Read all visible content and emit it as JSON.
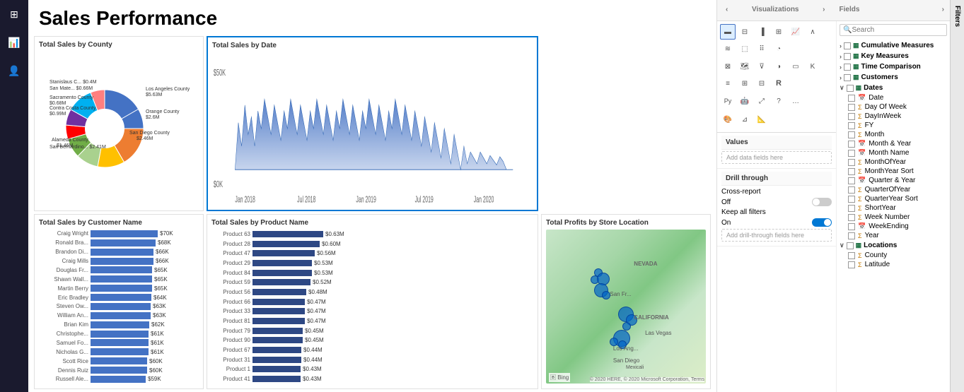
{
  "app": {
    "title": "Sales Performance",
    "sidebar_icons": [
      "grid",
      "bar-chart",
      "user"
    ]
  },
  "charts": {
    "county_donut": {
      "title": "Total Sales by County",
      "segments": [
        {
          "label": "Los Angeles County",
          "value": "$5.63M",
          "color": "#4472c4",
          "pct": 28
        },
        {
          "label": "Orange County",
          "value": "$2.6M",
          "color": "#ed7d31",
          "pct": 13
        },
        {
          "label": "San Diego County",
          "value": "$2.46M",
          "color": "#a9d18e",
          "pct": 12
        },
        {
          "label": "San Bernardino...",
          "value": "$2.41M",
          "color": "#ffc000",
          "pct": 12
        },
        {
          "label": "Alameda County",
          "value": "$1.46M",
          "color": "#5b9bd5",
          "pct": 7
        },
        {
          "label": "Contra Costa County",
          "value": "$0.99M",
          "color": "#70ad47",
          "pct": 5
        },
        {
          "label": "Sacramento County",
          "value": "$0.68M",
          "color": "#ff0000",
          "pct": 3
        },
        {
          "label": "San Mate...",
          "value": "$0.66M",
          "color": "#7030a0",
          "pct": 3
        },
        {
          "label": "Stanislaus C...",
          "value": "$0.4M",
          "color": "#00b0f0",
          "pct": 2
        }
      ]
    },
    "date_line": {
      "title": "Total Sales by Date",
      "y_label": "$50K",
      "y_label_bottom": "$0K",
      "x_labels": [
        "Jan 2018",
        "Jul 2018",
        "Jan 2019",
        "Jul 2019",
        "Jan 2020"
      ]
    },
    "customer": {
      "title": "Total Sales by Customer Name",
      "rows": [
        {
          "name": "Craig Wright",
          "value": "$70K",
          "width": 95
        },
        {
          "name": "Ronald Bra...",
          "value": "$68K",
          "width": 92
        },
        {
          "name": "Brandon Di...",
          "value": "$66K",
          "width": 89
        },
        {
          "name": "Craig Mills",
          "value": "$66K",
          "width": 89
        },
        {
          "name": "Douglas Fr...",
          "value": "$65K",
          "width": 87
        },
        {
          "name": "Shawn Wall...",
          "value": "$65K",
          "width": 87
        },
        {
          "name": "Martin Berry",
          "value": "$65K",
          "width": 87
        },
        {
          "name": "Eric Bradley",
          "value": "$64K",
          "width": 86
        },
        {
          "name": "Steven Ow...",
          "value": "$63K",
          "width": 85
        },
        {
          "name": "William An...",
          "value": "$63K",
          "width": 85
        },
        {
          "name": "Brian Kim",
          "value": "$62K",
          "width": 83
        },
        {
          "name": "Christophe...",
          "value": "$61K",
          "width": 82
        },
        {
          "name": "Samuel Fo...",
          "value": "$61K",
          "width": 82
        },
        {
          "name": "Nicholas G...",
          "value": "$61K",
          "width": 82
        },
        {
          "name": "Scott Rice",
          "value": "$60K",
          "width": 80
        },
        {
          "name": "Dennis Ruiz",
          "value": "$60K",
          "width": 80
        },
        {
          "name": "Russell Ale...",
          "value": "$59K",
          "width": 78
        }
      ]
    },
    "product": {
      "title": "Total Sales by Product Name",
      "rows": [
        {
          "name": "Product 63",
          "value": "$0.63M",
          "width": 100
        },
        {
          "name": "Product 28",
          "value": "$0.60M",
          "width": 95
        },
        {
          "name": "Product 47",
          "value": "$0.56M",
          "width": 88
        },
        {
          "name": "Product 29",
          "value": "$0.53M",
          "width": 84
        },
        {
          "name": "Product 84",
          "value": "$0.53M",
          "width": 84
        },
        {
          "name": "Product 59",
          "value": "$0.52M",
          "width": 82
        },
        {
          "name": "Product 56",
          "value": "$0.48M",
          "width": 76
        },
        {
          "name": "Product 66",
          "value": "$0.47M",
          "width": 74
        },
        {
          "name": "Product 33",
          "value": "$0.47M",
          "width": 74
        },
        {
          "name": "Product 81",
          "value": "$0.47M",
          "width": 74
        },
        {
          "name": "Product 79",
          "value": "$0.45M",
          "width": 71
        },
        {
          "name": "Product 90",
          "value": "$0.45M",
          "width": 71
        },
        {
          "name": "Product 67",
          "value": "$0.44M",
          "width": 69
        },
        {
          "name": "Product 31",
          "value": "$0.44M",
          "width": 69
        },
        {
          "name": "Product 1",
          "value": "$0.43M",
          "width": 68
        },
        {
          "name": "Product 41",
          "value": "$0.43M",
          "width": 68
        }
      ]
    },
    "map": {
      "title": "Total Profits by Store Location",
      "copyright": "© 2020 HERE, © 2020 Microsoft Corporation, Terms"
    }
  },
  "viz_panel": {
    "title": "Visualizations",
    "nav_left": "‹",
    "nav_right": "›"
  },
  "fields_panel": {
    "title": "Fields",
    "search_placeholder": "Search",
    "groups": [
      {
        "name": "Cumulative Measures",
        "icon": "table",
        "expanded": false,
        "items": []
      },
      {
        "name": "Key Measures",
        "icon": "table",
        "expanded": false,
        "items": []
      },
      {
        "name": "Time Comparison",
        "icon": "table",
        "expanded": false,
        "items": []
      },
      {
        "name": "Customers",
        "icon": "table",
        "expanded": false,
        "items": []
      },
      {
        "name": "Dates",
        "icon": "table",
        "expanded": true,
        "items": [
          {
            "label": "Date",
            "icon": "calendar",
            "checked": false
          },
          {
            "label": "Day Of Week",
            "icon": "sigma",
            "checked": false
          },
          {
            "label": "DayInWeek",
            "icon": "sigma",
            "checked": false
          },
          {
            "label": "FY",
            "icon": "sigma",
            "checked": false
          },
          {
            "label": "Month",
            "icon": "sigma",
            "checked": false
          },
          {
            "label": "Month & Year",
            "icon": "calendar",
            "checked": false
          },
          {
            "label": "Month Name",
            "icon": "calendar",
            "checked": false
          },
          {
            "label": "MonthOfYear",
            "icon": "sigma",
            "checked": false
          },
          {
            "label": "MonthYear Sort",
            "icon": "sigma",
            "checked": false
          },
          {
            "label": "Quarter & Year",
            "icon": "calendar",
            "checked": false
          },
          {
            "label": "QuarterOfYear",
            "icon": "sigma",
            "checked": false
          },
          {
            "label": "QuarterYear Sort",
            "icon": "sigma",
            "checked": false
          },
          {
            "label": "ShortYear",
            "icon": "sigma",
            "checked": false
          },
          {
            "label": "Week Number",
            "icon": "sigma",
            "checked": false
          },
          {
            "label": "WeekEnding",
            "icon": "calendar",
            "checked": false
          },
          {
            "label": "Year",
            "icon": "sigma",
            "checked": false
          }
        ]
      },
      {
        "name": "Locations",
        "icon": "table",
        "expanded": true,
        "items": [
          {
            "label": "County",
            "icon": "sigma",
            "checked": false
          },
          {
            "label": "Latitude",
            "icon": "sigma",
            "checked": false
          }
        ]
      }
    ],
    "values_label": "Values",
    "add_fields_placeholder": "Add data fields here",
    "drill_through_label": "Drill through",
    "cross_report_label": "Cross-report",
    "cross_report_state": "Off",
    "keep_filters_label": "Keep all filters",
    "keep_filters_state": "On",
    "add_drill_placeholder": "Add drill-through fields here"
  },
  "filters_label": "Filters"
}
